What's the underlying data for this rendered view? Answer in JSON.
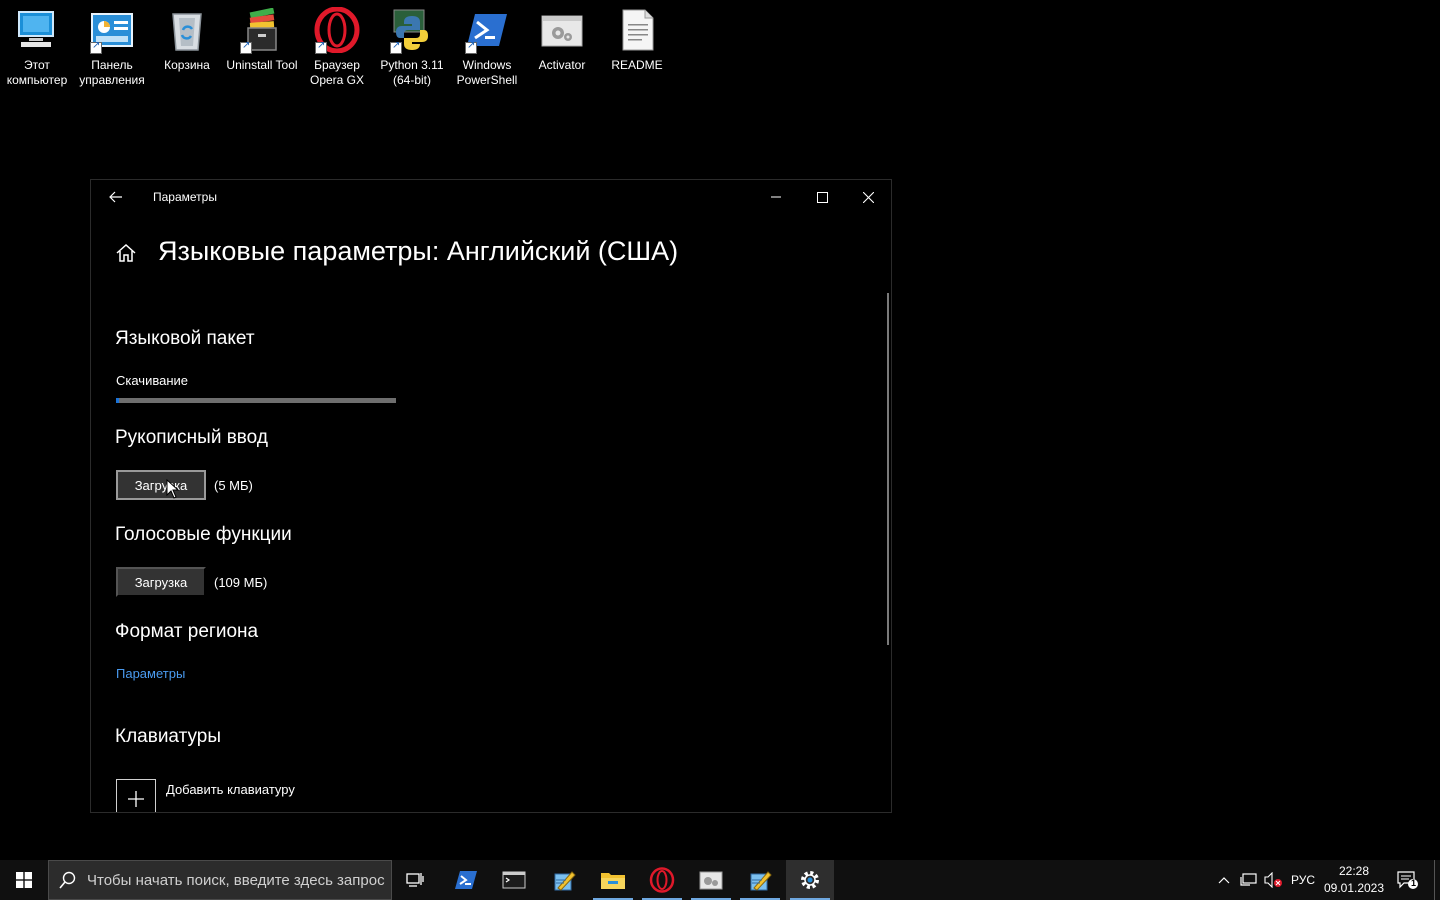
{
  "desktop": {
    "icons": [
      {
        "label": "Этот\nкомпьютер",
        "icon": "this-pc-icon"
      },
      {
        "label": "Панель\nуправления",
        "icon": "control-panel-icon"
      },
      {
        "label": "Корзина",
        "icon": "recycle-bin-icon"
      },
      {
        "label": "Uninstall Tool",
        "icon": "uninstall-tool-icon"
      },
      {
        "label": "Браузер\nOpera GX",
        "icon": "opera-gx-icon"
      },
      {
        "label": "Python 3.11\n(64-bit)",
        "icon": "python-icon"
      },
      {
        "label": "Windows\nPowerShell",
        "icon": "powershell-icon"
      },
      {
        "label": "Activator",
        "icon": "activator-icon"
      },
      {
        "label": "README",
        "icon": "text-file-icon"
      }
    ]
  },
  "window": {
    "title": "Параметры",
    "page_title": "Языковые параметры: Английский (США)",
    "language_pack": {
      "heading": "Языковой пакет",
      "status": "Скачивание",
      "progress": 0.01
    },
    "handwriting": {
      "heading": "Рукописный ввод",
      "button": "Загрузка",
      "size": "(5 МБ)"
    },
    "speech": {
      "heading": "Голосовые функции",
      "button": "Загрузка",
      "size": "(109 МБ)"
    },
    "region": {
      "heading": "Формат региона",
      "link": "Параметры"
    },
    "keyboards": {
      "heading": "Клавиатуры",
      "add_label": "Добавить клавиатуру"
    }
  },
  "taskbar": {
    "search_placeholder": "Чтобы начать поиск, введите здесь запрос",
    "apps": [
      "task-view-icon",
      "powershell-icon",
      "terminal-icon",
      "notepad-icon",
      "file-explorer-icon",
      "opera-gx-icon",
      "control-panel-icon",
      "notepad-icon",
      "settings-icon"
    ],
    "language": "РУС",
    "time": "22:28",
    "date": "09.01.2023",
    "notification_count": "1"
  },
  "colors": {
    "accent": "#1a73d9",
    "link": "#4a9bf0",
    "opera_red": "#e0192a"
  }
}
